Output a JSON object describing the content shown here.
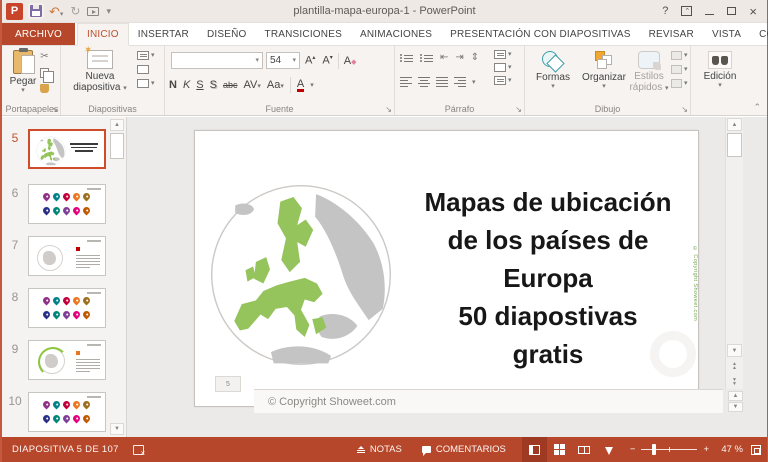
{
  "window": {
    "title": "plantilla-mapa-europa-1 - PowerPoint",
    "help": "?"
  },
  "tabs": [
    {
      "label": "ARCHIVO"
    },
    {
      "label": "INICIO"
    },
    {
      "label": "INSERTAR"
    },
    {
      "label": "DISEÑO"
    },
    {
      "label": "TRANSICIONES"
    },
    {
      "label": "ANIMACIONES"
    },
    {
      "label": "PRESENTACIÓN CON DIAPOSITIVAS"
    },
    {
      "label": "REVISAR"
    },
    {
      "label": "VISTA"
    },
    {
      "label": "COMPLE"
    }
  ],
  "ribbon": {
    "groups": [
      "Portapapeles",
      "Diapositivas",
      "Fuente",
      "Párrafo",
      "Dibujo"
    ],
    "paste": "Pegar",
    "new_slide_1": "Nueva",
    "new_slide_2": "diapositiva",
    "font_size": "54",
    "font_buttons": [
      "N",
      "K",
      "S",
      "S",
      "abc",
      "AV",
      "Aa",
      "A"
    ],
    "shapes": "Formas",
    "arrange": "Organizar",
    "quick_styles_1": "Estilos",
    "quick_styles_2": "rápidos",
    "edit": "Edición"
  },
  "thumbnails": {
    "numbers": [
      "5",
      "6",
      "7",
      "8",
      "9",
      "10"
    ]
  },
  "slide": {
    "lines": [
      "Mapas de ubicación",
      "de los países de",
      "Europa",
      "50 diapostivas",
      "gratis"
    ],
    "number": "5",
    "copyright": "© Copyright Showeet.com"
  },
  "notes": {
    "text": "© Copyright Showeet.com"
  },
  "status": {
    "slide_indicator": "DIAPOSITIVA 5 DE 107",
    "notas": "NOTAS",
    "comentarios": "COMENTARIOS",
    "zoom_minus": "−",
    "zoom_plus": "+",
    "zoom_level": "47 %"
  },
  "colors": {
    "accent": "#B7472A",
    "accentDark": "#9E3A22",
    "tabActive": "#C0502F",
    "selBorder": "#D04B27",
    "mapGreen": "#95C45D",
    "mapGray": "#C4C4C4",
    "copyGreen": "#70A94F"
  }
}
